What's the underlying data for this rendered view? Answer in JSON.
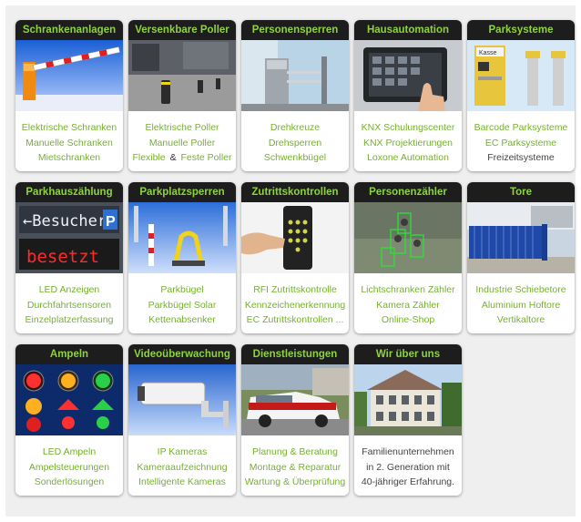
{
  "cards": [
    {
      "title": "Schrankenanlagen",
      "links": [
        "Elektrische Schranken",
        "Manuelle Schranken",
        "Mietschranken"
      ]
    },
    {
      "title": "Versenkbare Poller",
      "links": [
        "Elektrische Poller",
        "Manuelle Poller"
      ],
      "mixed": {
        "a": "Flexible",
        "sep": "&",
        "b": "Feste Poller"
      }
    },
    {
      "title": "Personensperren",
      "links": [
        "Drehkreuze",
        "Drehsperren",
        "Schwenkbügel"
      ]
    },
    {
      "title": "Hausautomation",
      "links": [
        "KNX Schulungscenter",
        "KNX Projektierungen",
        "Loxone Automation"
      ]
    },
    {
      "title": "Parksysteme",
      "links": [
        "Barcode Parksysteme",
        "EC Parksysteme"
      ],
      "plain": "Freizeitsysteme",
      "image_label": "Kasse"
    },
    {
      "title": "Parkhauszählung",
      "links": [
        "LED Anzeigen",
        "Durchfahrtsensoren",
        "Einzelplatzerfassung"
      ],
      "image_line1": "←Besucher",
      "image_p": "P",
      "image_line2": "besetzt"
    },
    {
      "title": "Parkplatzsperren",
      "links": [
        "Parkbügel",
        "Parkbügel Solar",
        "Kettenabsenker"
      ]
    },
    {
      "title": "Zutrittskontrollen",
      "links": [
        "RFI Zutrittskontrolle",
        "Kennzeichenerkennung",
        "EC Zutrittskontrollen ..."
      ]
    },
    {
      "title": "Personenzähler",
      "links": [
        "Lichtschranken Zähler",
        "Kamera Zähler",
        "Online-Shop"
      ]
    },
    {
      "title": "Tore",
      "links": [
        "Industrie Schiebetore",
        "Aluminium Hoftore",
        "Vertikaltore"
      ]
    },
    {
      "title": "Ampeln",
      "links": [
        "LED Ampeln",
        "Ampelsteuerungen",
        "Sonderlösungen"
      ]
    },
    {
      "title": "Videoüberwachung",
      "links": [
        "IP Kameras",
        "Kameraaufzeichnung",
        "Intelligente Kameras"
      ]
    },
    {
      "title": "Dienstleistungen",
      "links": [
        "Planung & Beratung",
        "Montage & Reparatur",
        "Wartung & Überprüfung"
      ]
    },
    {
      "title": "Wir über uns",
      "text": [
        "Familienunternehmen",
        "in 2. Generation mit",
        "40-jähriger Erfahrung."
      ]
    }
  ],
  "colors": {
    "title_bg": "#1d1d1d",
    "title_text": "#8fd33a",
    "link": "#74b22d",
    "page_bg": "#efefef"
  }
}
